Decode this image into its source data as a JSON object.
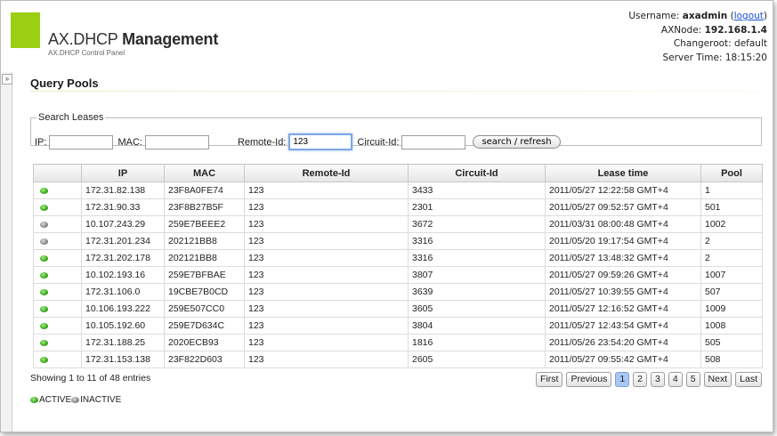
{
  "header": {
    "title_light": "AX.DHCP",
    "title_bold": "Management",
    "subtitle": "AX.DHCP Control Panel",
    "username_label": "Username:",
    "username": "axadmin",
    "logout": "logout",
    "axnode_label": "AXNode:",
    "axnode": "192.168.1.4",
    "changeroot_label": "Changeroot:",
    "changeroot": "default",
    "server_time_label": "Server Time:",
    "server_time": "18:15:20",
    "logo_color": "#9bcf12"
  },
  "sidebar_toggle": "»",
  "page_title": "Query Pools",
  "search": {
    "legend": "Search Leases",
    "ip_label": "IP:",
    "ip_value": "",
    "mac_label": "MAC:",
    "mac_value": "",
    "remote_id_label": "Remote-Id:",
    "remote_id_value": "123",
    "circuit_id_label": "Circuit-Id:",
    "circuit_id_value": "",
    "button": "search / refresh"
  },
  "table": {
    "columns": [
      "",
      "IP",
      "MAC",
      "Remote-Id",
      "Circuit-Id",
      "Lease time",
      "Pool"
    ],
    "rows": [
      {
        "status": "active",
        "ip": "172.31.82.138",
        "mac": "23F8A0FE74",
        "remote_id": "123",
        "circuit_id": "3433",
        "lease_time": "2011/05/27 12:22:58 GMT+4",
        "pool": "1"
      },
      {
        "status": "active",
        "ip": "172.31.90.33",
        "mac": "23F8B27B5F",
        "remote_id": "123",
        "circuit_id": "2301",
        "lease_time": "2011/05/27 09:52:57 GMT+4",
        "pool": "501"
      },
      {
        "status": "inactive",
        "ip": "10.107.243.29",
        "mac": "259E7BEEE2",
        "remote_id": "123",
        "circuit_id": "3672",
        "lease_time": "2011/03/31 08:00:48 GMT+4",
        "pool": "1002"
      },
      {
        "status": "inactive",
        "ip": "172.31.201.234",
        "mac": "202121BB8",
        "remote_id": "123",
        "circuit_id": "3316",
        "lease_time": "2011/05/20 19:17:54 GMT+4",
        "pool": "2"
      },
      {
        "status": "active",
        "ip": "172.31.202.178",
        "mac": "202121BB8",
        "remote_id": "123",
        "circuit_id": "3316",
        "lease_time": "2011/05/27 13:48:32 GMT+4",
        "pool": "2"
      },
      {
        "status": "active",
        "ip": "10.102.193.16",
        "mac": "259E7BFBAE",
        "remote_id": "123",
        "circuit_id": "3807",
        "lease_time": "2011/05/27 09:59:26 GMT+4",
        "pool": "1007"
      },
      {
        "status": "active",
        "ip": "172.31.106.0",
        "mac": "19CBE7B0CD",
        "remote_id": "123",
        "circuit_id": "3639",
        "lease_time": "2011/05/27 10:39:55 GMT+4",
        "pool": "507"
      },
      {
        "status": "active",
        "ip": "10.106.193.222",
        "mac": "259E507CC0",
        "remote_id": "123",
        "circuit_id": "3605",
        "lease_time": "2011/05/27 12:16:52 GMT+4",
        "pool": "1009"
      },
      {
        "status": "active",
        "ip": "10.105.192.60",
        "mac": "259E7D634C",
        "remote_id": "123",
        "circuit_id": "3804",
        "lease_time": "2011/05/27 12:43:54 GMT+4",
        "pool": "1008"
      },
      {
        "status": "active",
        "ip": "172.31.188.25",
        "mac": "2020ECB93",
        "remote_id": "123",
        "circuit_id": "1816",
        "lease_time": "2011/05/26 23:54:20 GMT+4",
        "pool": "505"
      },
      {
        "status": "active",
        "ip": "172.31.153.138",
        "mac": "23F822D603",
        "remote_id": "123",
        "circuit_id": "2605",
        "lease_time": "2011/05/27 09:55:42 GMT+4",
        "pool": "508"
      }
    ]
  },
  "entries_info": "Showing 1 to 11 of 48 entries",
  "pagination": {
    "first": "First",
    "previous": "Previous",
    "pages": [
      "1",
      "2",
      "3",
      "4",
      "5"
    ],
    "current": "1",
    "next": "Next",
    "last": "Last"
  },
  "legend": {
    "active": "ACTIVE",
    "inactive": "INACTIVE"
  }
}
